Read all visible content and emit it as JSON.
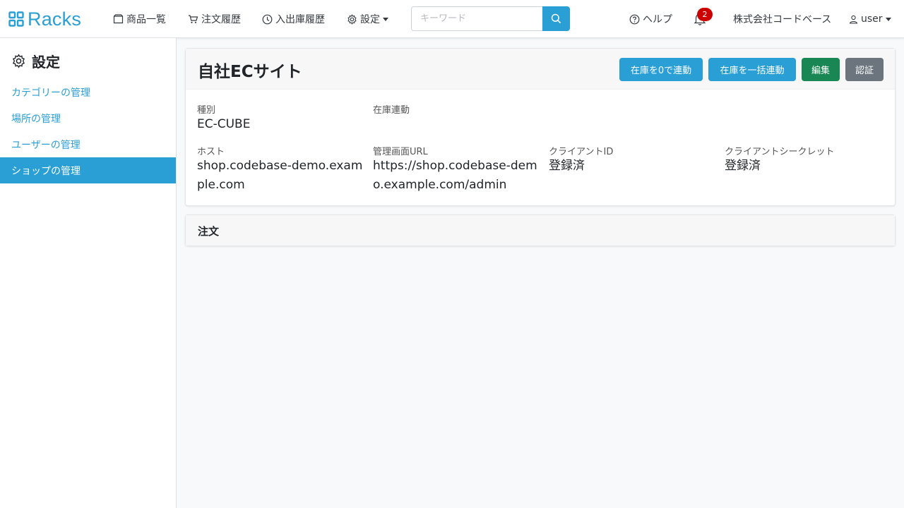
{
  "brand": {
    "name": "Racks"
  },
  "nav": {
    "products": "商品一覧",
    "orders": "注文履歴",
    "stock_history": "入出庫履歴",
    "settings": "設定",
    "help": "ヘルプ",
    "notifications_count": "2",
    "company": "株式会社コードベース",
    "user": "user"
  },
  "search": {
    "placeholder": "キーワード"
  },
  "sidebar": {
    "title": "設定",
    "items": [
      {
        "label": "カテゴリーの管理",
        "active": false
      },
      {
        "label": "場所の管理",
        "active": false
      },
      {
        "label": "ユーザーの管理",
        "active": false
      },
      {
        "label": "ショップの管理",
        "active": true
      }
    ]
  },
  "shop": {
    "name": "自社ECサイト",
    "buttons": {
      "sync_zero": "在庫を0で連動",
      "sync_bulk": "在庫を一括連動",
      "edit": "編集",
      "auth": "認証"
    },
    "fields": {
      "type_label": "種別",
      "type_value": "EC-CUBE",
      "stock_sync_label": "在庫連動",
      "stock_sync_value": "",
      "host_label": "ホスト",
      "host_value": "shop.codebase-demo.example.com",
      "admin_url_label": "管理画面URL",
      "admin_url_value": "https://shop.codebase-demo.example.com/admin",
      "client_id_label": "クライアントID",
      "client_id_value": "登録済",
      "client_secret_label": "クライアントシークレット",
      "client_secret_value": "登録済"
    }
  },
  "orders_section": {
    "title": "注文"
  },
  "colors": {
    "primary": "#2a9fd6",
    "success": "#198754",
    "secondary": "#6c757d",
    "badge": "#cc0000"
  }
}
